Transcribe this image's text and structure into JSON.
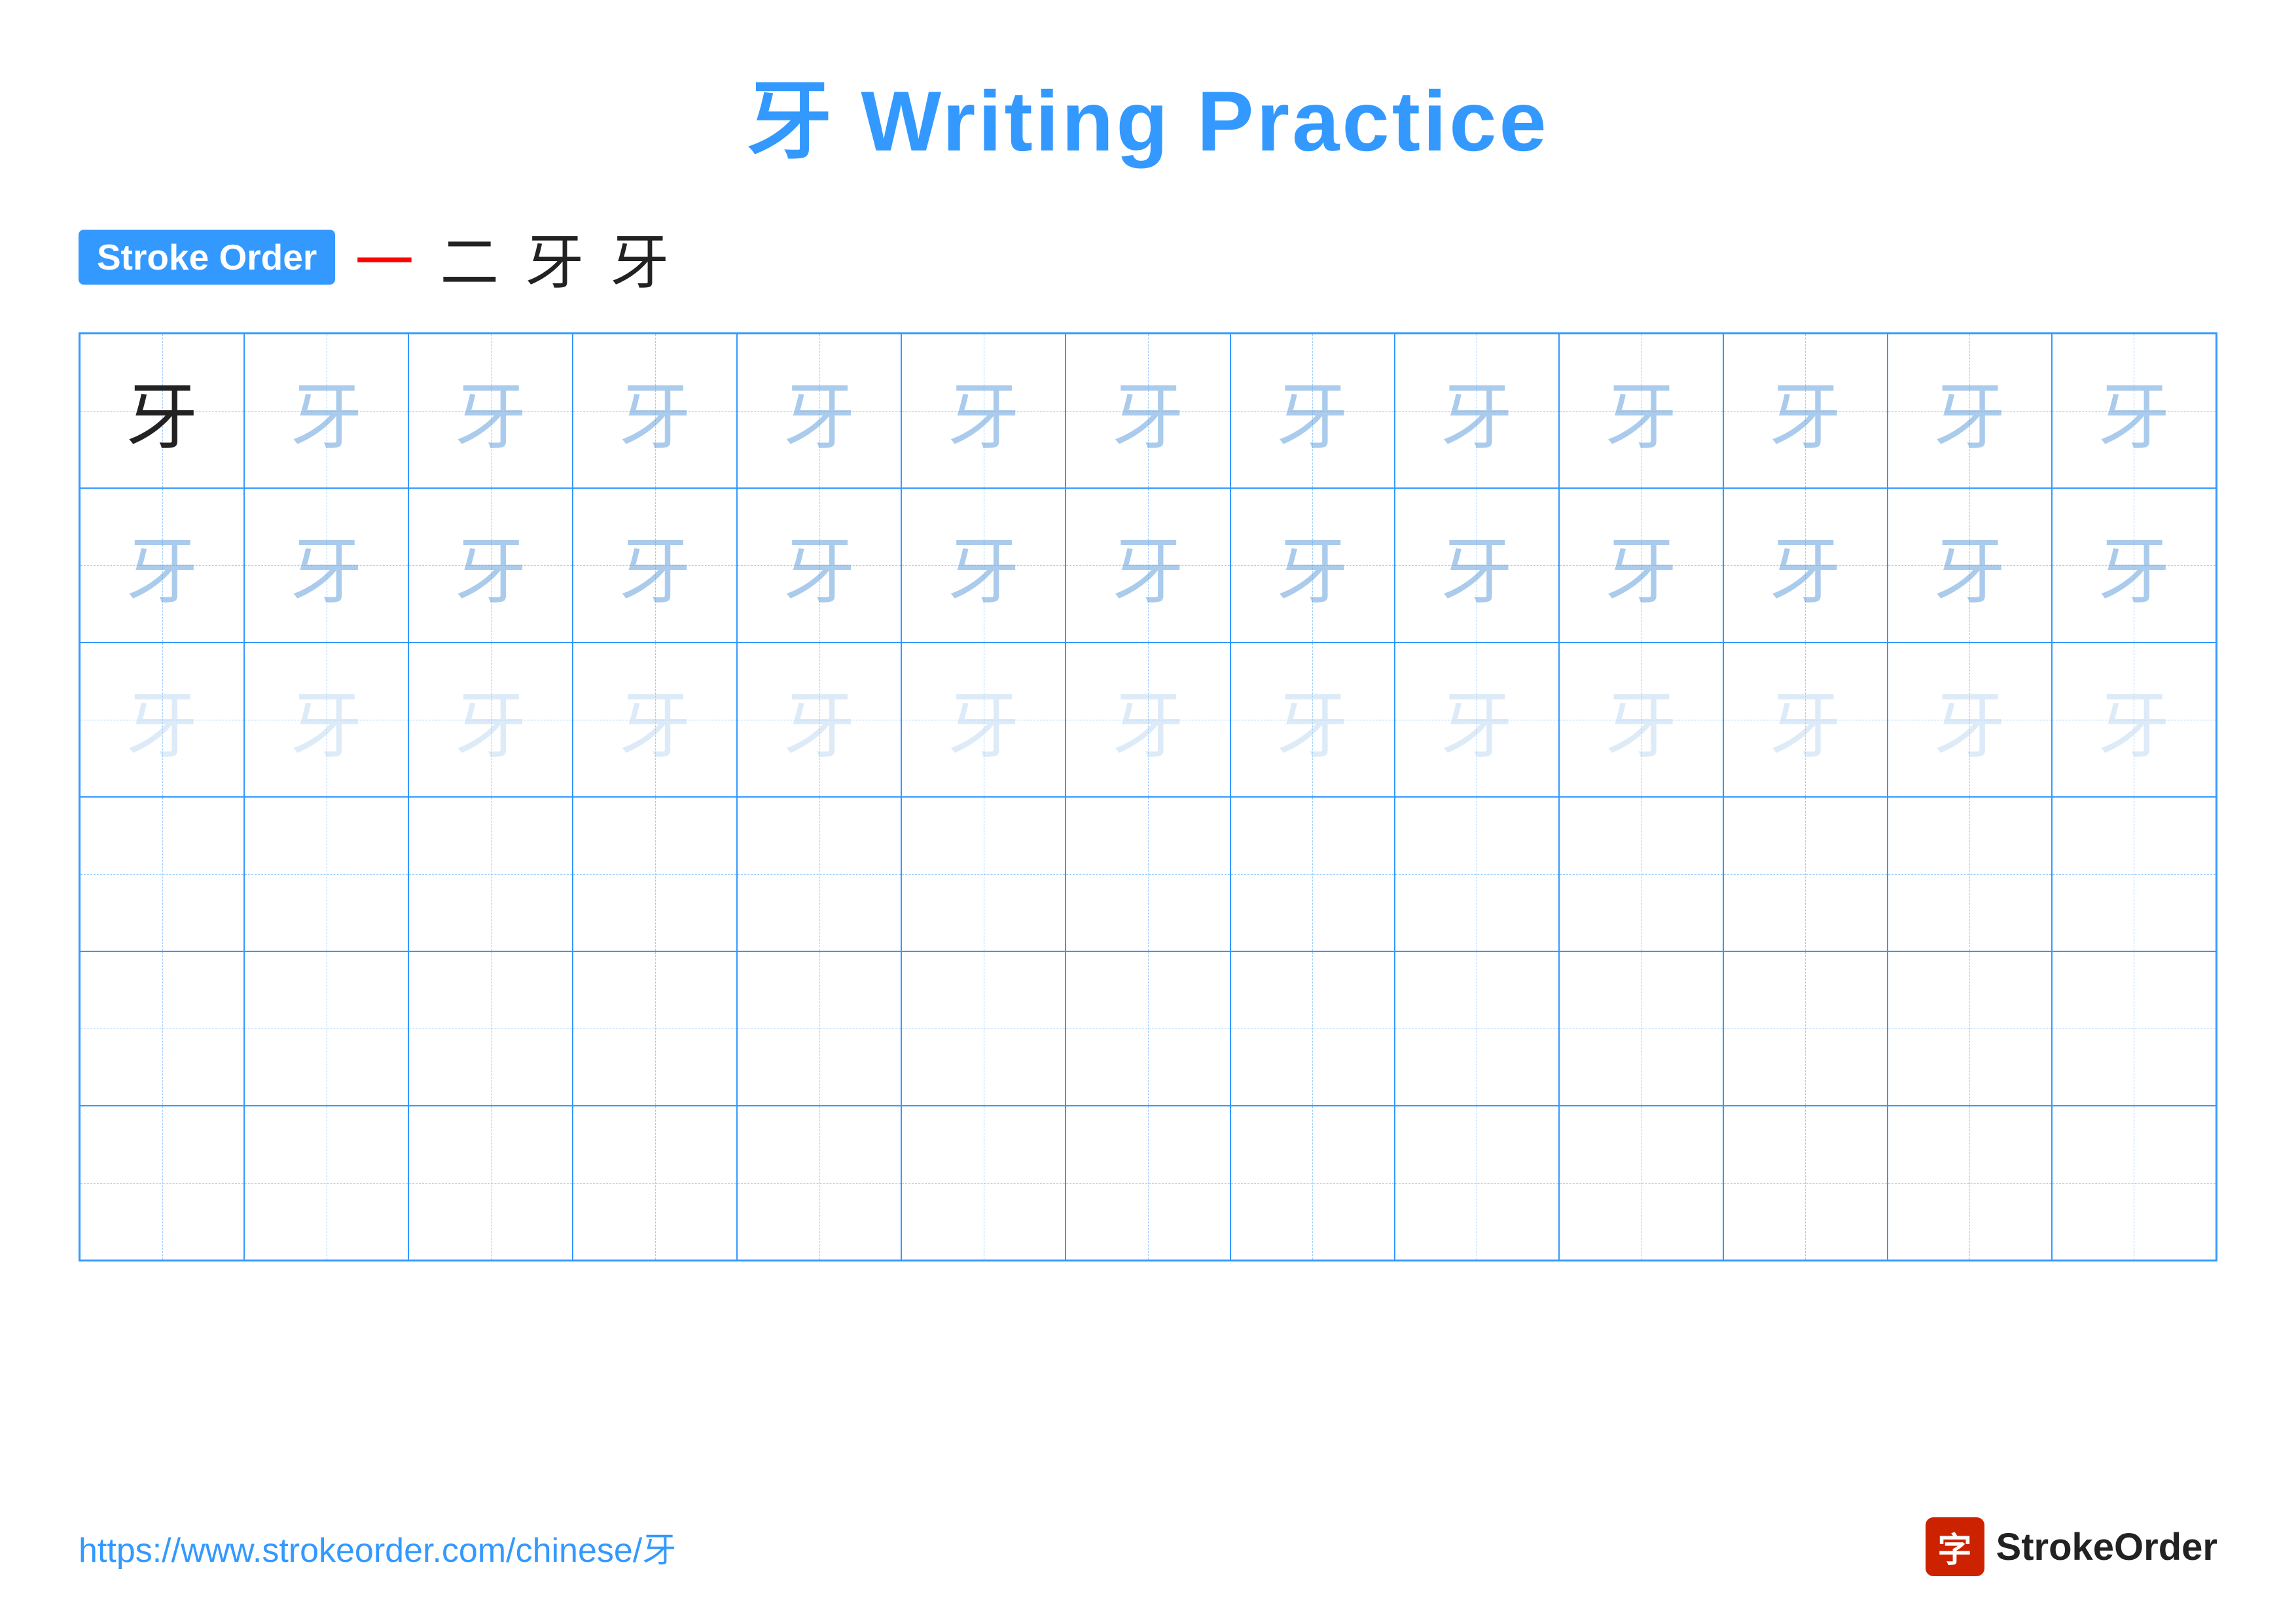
{
  "title": {
    "char": "牙",
    "text": "Writing Practice",
    "full": "牙 Writing Practice"
  },
  "stroke_order": {
    "badge_label": "Stroke Order",
    "steps": [
      "一",
      "二",
      "牙",
      "牙"
    ]
  },
  "grid": {
    "rows": 6,
    "cols": 13,
    "char": "牙",
    "row_types": [
      "solid_then_medium",
      "medium",
      "light",
      "empty",
      "empty",
      "empty"
    ]
  },
  "footer": {
    "url": "https://www.strokeorder.com/chinese/牙",
    "logo_char": "字",
    "logo_text": "StrokeOrder"
  }
}
